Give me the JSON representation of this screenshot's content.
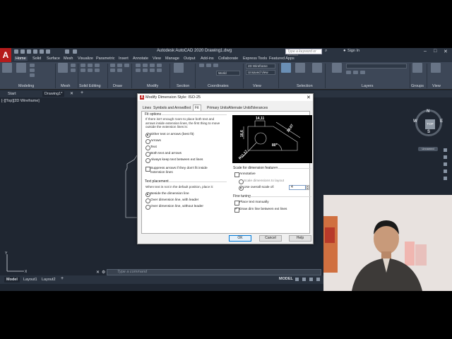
{
  "app": {
    "title": "Autodesk AutoCAD 2020   Drawing1.dwg",
    "search_placeholder": "Type a keyword or phrase",
    "signin": "Sign In",
    "logo_letter": "A"
  },
  "ribbon": {
    "tabs": [
      "Home",
      "Solid",
      "Surface",
      "Mesh",
      "Visualize",
      "Parametric",
      "Insert",
      "Annotate",
      "View",
      "Manage",
      "Output",
      "Add-ins",
      "Collaborate",
      "Express Tools",
      "Featured Apps"
    ],
    "active_tab": "Home",
    "panels": [
      "Modeling",
      "Mesh",
      "Solid Editing",
      "Draw",
      "Modify",
      "Section",
      "Coordinates",
      "View",
      "Selection",
      "Layers",
      "Groups",
      "View"
    ],
    "view_dropdowns": [
      "2D Wireframe",
      "Unsaved View",
      "World"
    ]
  },
  "document_tabs": [
    "Start",
    "Drawing1*"
  ],
  "viewport_label": "[-][Top][2D Wireframe]",
  "viewcube": {
    "top": "TOP",
    "north": "N",
    "south": "S",
    "east": "E",
    "west": "W",
    "wcs": "Unnamed"
  },
  "command_line": {
    "placeholder": "Type a command"
  },
  "layout_tabs": [
    "Model",
    "Layout1",
    "Layout2"
  ],
  "status": {
    "model": "MODEL"
  },
  "dialog": {
    "title": "Modify Dimension Style: ISO-25",
    "tabs": [
      "Lines",
      "Symbols and Arrows",
      "Text",
      "Fit",
      "Primary Units",
      "Alternate Units",
      "Tolerances"
    ],
    "active_tab": "Fit",
    "fit_options": {
      "label": "Fit options",
      "description": "If there isn't enough room to place both text and arrows inside extension lines, the first thing to move outside the extension lines is:",
      "options": [
        "Either text or arrows (best fit)",
        "Arrows",
        "Text",
        "Both text and arrows",
        "Always keep text between ext lines"
      ],
      "selected": 0,
      "suppress_label": "Suppress arrows if they don't fit inside extension lines"
    },
    "text_placement": {
      "label": "Text placement",
      "description": "When text is not in the default position, place it:",
      "options": [
        "Beside the dimension line",
        "Over dimension line, with leader",
        "Over dimension line, without leader"
      ],
      "selected": 0
    },
    "preview": {
      "values": [
        "14,11",
        "16,6",
        "28,07",
        "R11,17",
        "80°"
      ]
    },
    "scale": {
      "label": "Scale for dimension features",
      "annotative": "Annotative",
      "scale_layout": "Scale dimensions to layout",
      "overall_scale": "Use overall scale of:",
      "overall_value": "4"
    },
    "fine_tuning": {
      "label": "Fine tuning",
      "place_manually": "Place text manually",
      "draw_dim_line": "Draw dim line between ext lines"
    },
    "buttons": {
      "ok": "OK",
      "cancel": "Cancel",
      "help": "Help"
    }
  },
  "webcam": {
    "text": ""
  }
}
